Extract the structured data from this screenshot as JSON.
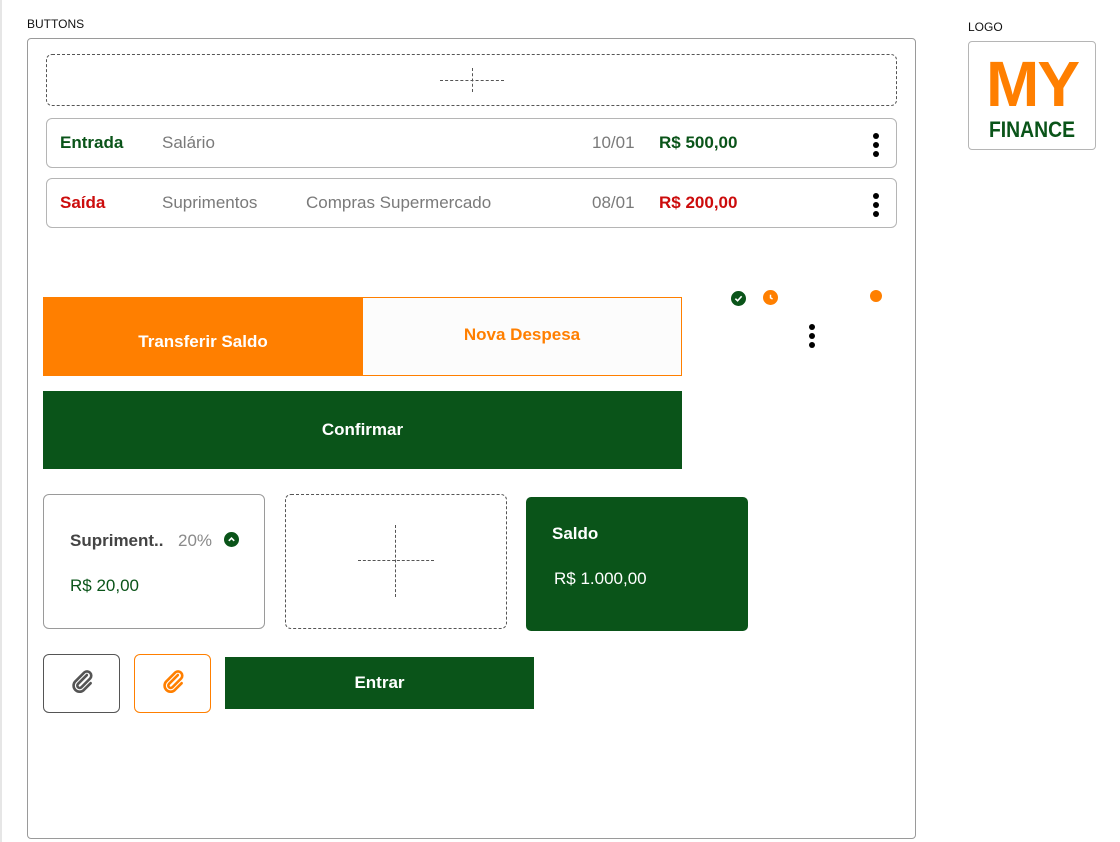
{
  "sections": {
    "buttons_label": "BUTTONS",
    "logo_label": "LOGO"
  },
  "transactions": [
    {
      "type": "Entrada",
      "category": "Salário",
      "description": "",
      "date": "10/01",
      "amount": "R$ 500,00",
      "kind": "income"
    },
    {
      "type": "Saída",
      "category": "Suprimentos",
      "description": "Compras Supermercado",
      "date": "08/01",
      "amount": "R$ 200,00",
      "kind": "expense"
    }
  ],
  "tabs": {
    "transfer_label": "Transferir Saldo",
    "expense_label": "Nova Despesa"
  },
  "actions": {
    "confirm_label": "Confirmar",
    "enter_label": "Entrar"
  },
  "status_icons": [
    "check-circle-icon",
    "clock-icon",
    "orange-dot-icon",
    "kebab-menu-icon"
  ],
  "budget_card": {
    "name": "Supriment..",
    "percent": "20%",
    "value": "R$ 20,00",
    "icon": "chevron-up-circle-icon"
  },
  "balance_card": {
    "title": "Saldo",
    "value": "R$ 1.000,00"
  },
  "attach_buttons": [
    "paperclip-icon",
    "paperclip-icon"
  ],
  "logo": {
    "line1": "MY",
    "line2": "FINANCE"
  },
  "colors": {
    "primary_green": "#0a5419",
    "accent_orange": "#ff7f00",
    "expense_red": "#cc0c0c",
    "muted_gray": "#7a7a7a"
  }
}
